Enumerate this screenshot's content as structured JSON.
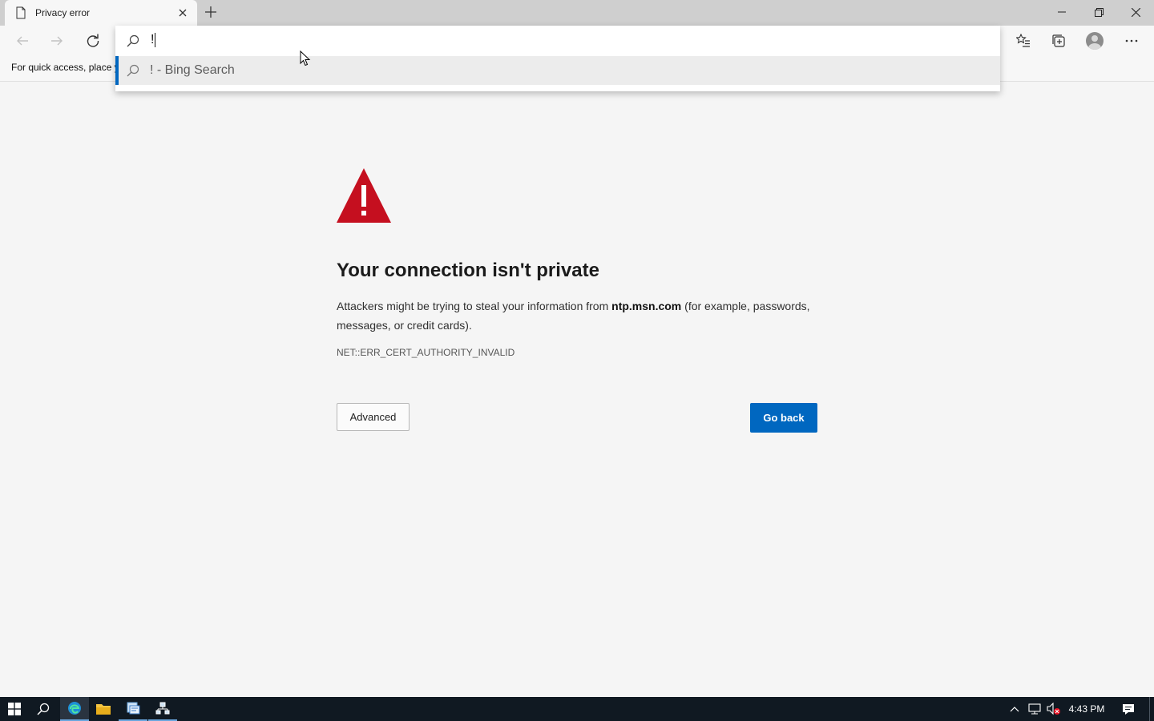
{
  "browser": {
    "tab": {
      "title": "Privacy error"
    },
    "favorites_bar": {
      "text": "For quick access, place your favorites here on the favorites bar."
    },
    "omnibox": {
      "value": "!",
      "suggestion": "! - Bing Search"
    }
  },
  "error_page": {
    "title": "Your connection isn't private",
    "description_before": "Attackers might be trying to steal your information from ",
    "domain": "ntp.msn.com",
    "description_after": " (for example, passwords, messages, or credit cards).",
    "error_code": "NET::ERR_CERT_AUTHORITY_INVALID",
    "advanced_label": "Advanced",
    "go_back_label": "Go back"
  },
  "taskbar": {
    "clock": "4:43 PM"
  },
  "colors": {
    "accent": "#0067c0",
    "warning": "#c50f1f",
    "taskbar": "#101922"
  },
  "icons": [
    "page-icon",
    "close-icon",
    "plus-icon",
    "minimize-icon",
    "restore-icon",
    "back-arrow-icon",
    "forward-arrow-icon",
    "reload-icon",
    "search-icon",
    "favorites-icon",
    "collections-icon",
    "profile-icon",
    "more-icon",
    "warning-triangle-icon",
    "windows-start-icon",
    "edge-icon",
    "folder-icon"
  ]
}
